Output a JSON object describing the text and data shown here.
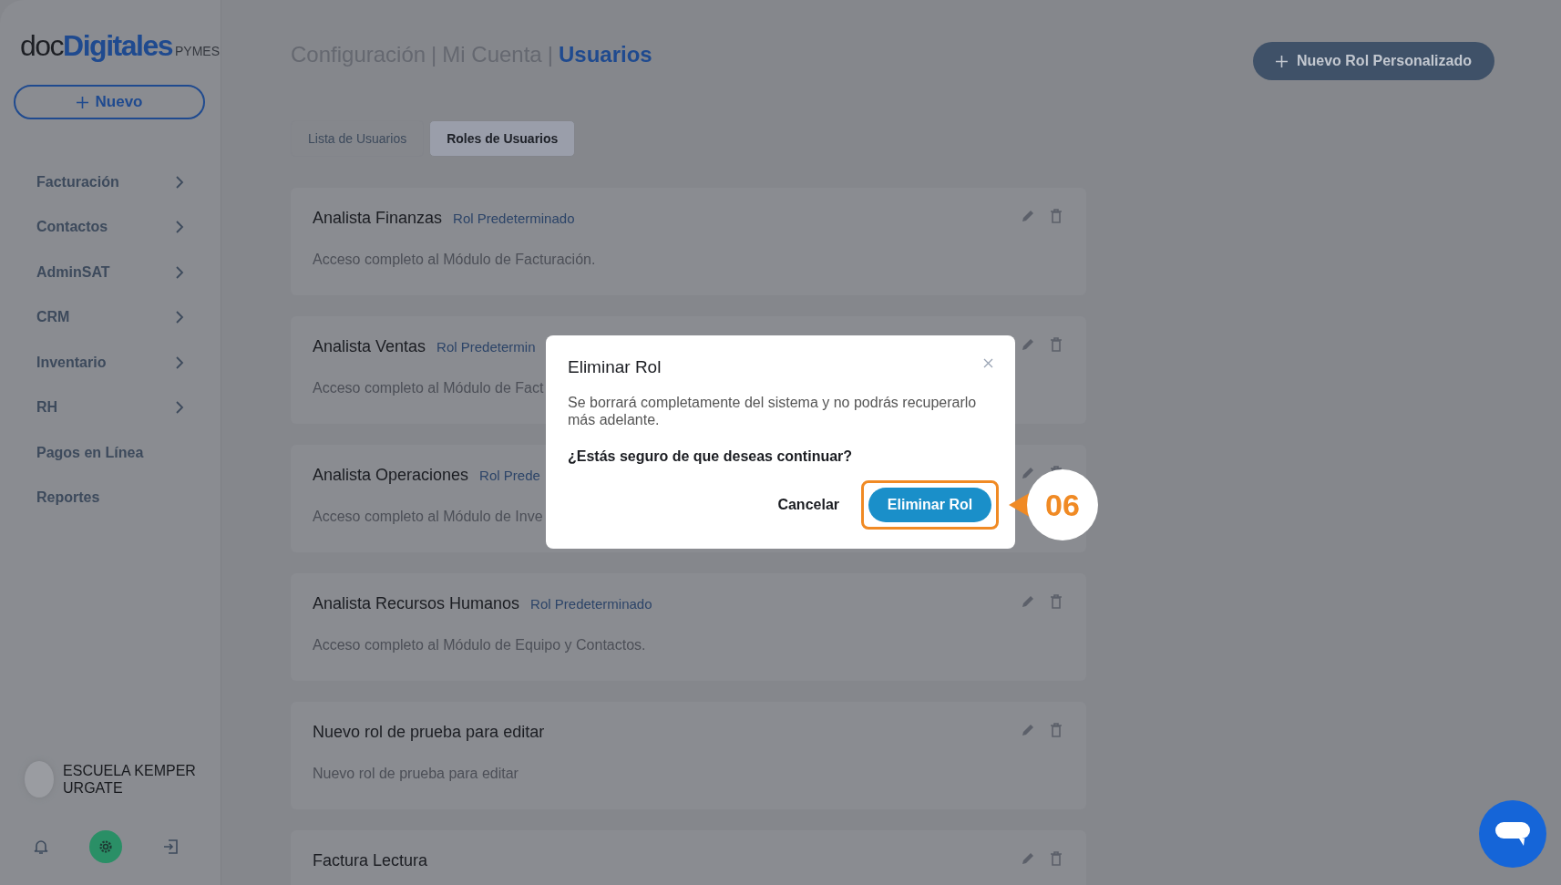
{
  "sidebar": {
    "logo": {
      "prefix": "doc",
      "brand": "Digitales",
      "suffix": "PYMES"
    },
    "new_button": "Nuevo",
    "items": [
      {
        "label": "Facturación",
        "kind": "group"
      },
      {
        "label": "Contactos",
        "kind": "group"
      },
      {
        "label": "AdminSAT",
        "kind": "group"
      },
      {
        "label": "CRM",
        "kind": "group"
      },
      {
        "label": "Inventario",
        "kind": "group"
      },
      {
        "label": "RH",
        "kind": "group"
      },
      {
        "label": "Pagos en Línea",
        "kind": "link"
      },
      {
        "label": "Reportes",
        "kind": "link"
      }
    ],
    "account": {
      "name": "ESCUELA KEMPER URGATE"
    }
  },
  "breadcrumb_separator": "|",
  "breadcrumb": [
    {
      "label": "Configuración",
      "selected": false
    },
    {
      "label": "Mi Cuenta",
      "selected": false
    },
    {
      "label": "Usuarios",
      "selected": true
    }
  ],
  "new_role_button": "Nuevo Rol Personalizado",
  "tabs": [
    {
      "label": "Lista de Usuarios",
      "selected": false
    },
    {
      "label": "Roles de Usuarios",
      "selected": true
    }
  ],
  "roles": [
    {
      "title": "Analista Finanzas",
      "tag": "Rol Predeterminado",
      "description": "Acceso completo al Módulo de Facturación."
    },
    {
      "title": "Analista Ventas",
      "tag": "Rol Predetermin",
      "description": "Acceso completo al Módulo de Fact"
    },
    {
      "title": "Analista Operaciones",
      "tag": "Rol Prede",
      "description": "Acceso completo al Módulo de Inve"
    },
    {
      "title": "Analista Recursos Humanos",
      "tag": "Rol Predeterminado",
      "description": "Acceso completo al Módulo de Equipo y Contactos."
    },
    {
      "title": "Nuevo rol de prueba para editar",
      "description": "Nuevo rol de prueba para editar"
    },
    {
      "title": "Factura Lectura"
    }
  ],
  "dialog": {
    "title": "Eliminar Rol",
    "message": "Se borrará completamente del sistema y no podrás recuperarlo más adelante.",
    "question": "¿Estás seguro de que deseas continuar?",
    "cancel": "Cancelar",
    "confirm": "Eliminar Rol",
    "callout": "06"
  }
}
